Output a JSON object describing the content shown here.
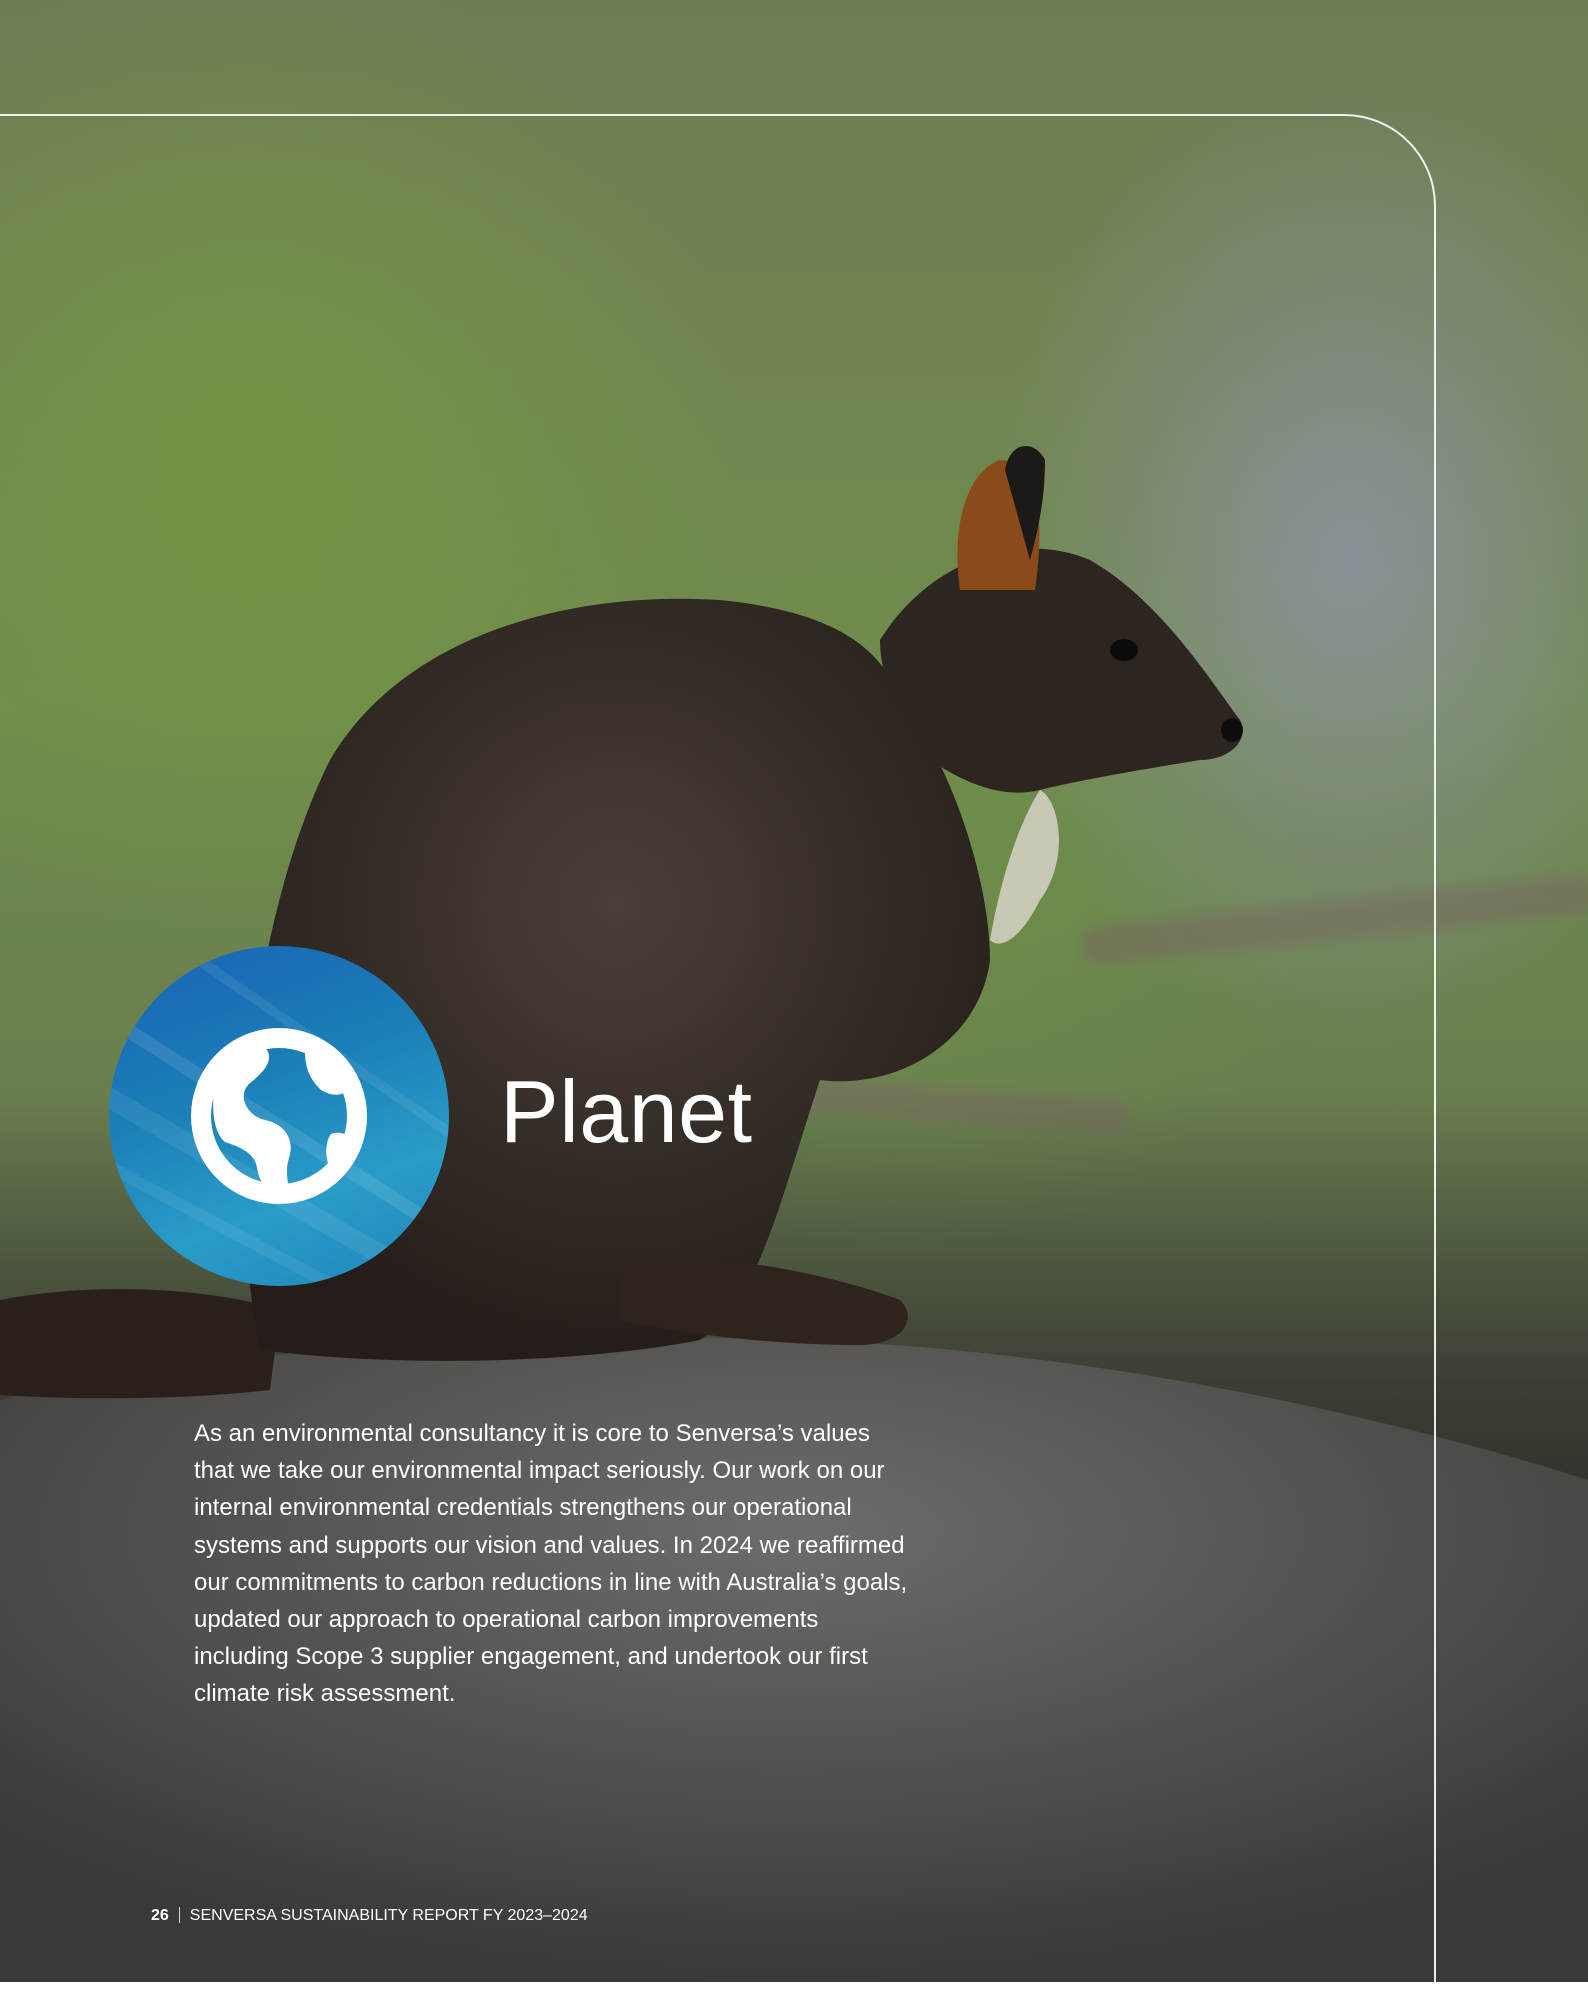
{
  "section": {
    "title": "Planet",
    "icon": "globe-icon",
    "badge_color": "#1a7fb7"
  },
  "intro": {
    "text": "As an environmental consultancy it is core to Senversa’s values that we take our environmental impact seriously. Our work on our internal environmental credentials strengthens our operational systems and supports our vision and values. In 2024 we reaffirmed our commitments to carbon reductions in line with Australia’s goals, updated our approach to operational carbon improvements including Scope 3 supplier engagement, and undertook our first climate risk assessment."
  },
  "footer": {
    "page_number": "26",
    "report_title": "SENVERSA SUSTAINABILITY REPORT FY 2023–2024"
  }
}
